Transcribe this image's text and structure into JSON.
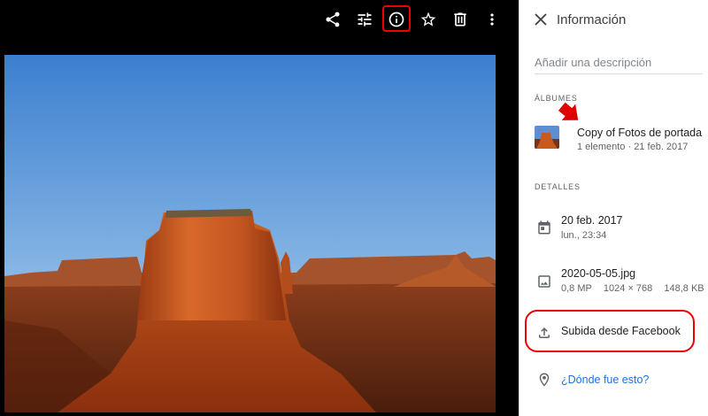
{
  "toolbar": {
    "buttons": [
      "share-icon",
      "edit-icon",
      "info-icon",
      "star-icon",
      "delete-icon",
      "more-vert-icon"
    ],
    "highlighted": "info-icon"
  },
  "panel": {
    "title": "Información",
    "description_placeholder": "Añadir una descripción",
    "albums_label": "ÁLBUMES",
    "album": {
      "title": "Copy of Fotos de portada",
      "count": "1 elemento",
      "date": "21 feb. 2017"
    },
    "details_label": "DETALLES",
    "date": {
      "main": "20 feb. 2017",
      "sub": "lun., 23:34"
    },
    "file": {
      "name": "2020-05-05.jpg",
      "megapixels": "0,8 MP",
      "dimensions": "1024 × 768",
      "size": "148,8 KB"
    },
    "upload": {
      "text": "Subida desde Facebook"
    },
    "location": {
      "link": "¿Dónde fue esto?"
    }
  },
  "colors": {
    "highlight": "#e00000",
    "link": "#1a73e8",
    "viewer_background": "#000000"
  }
}
